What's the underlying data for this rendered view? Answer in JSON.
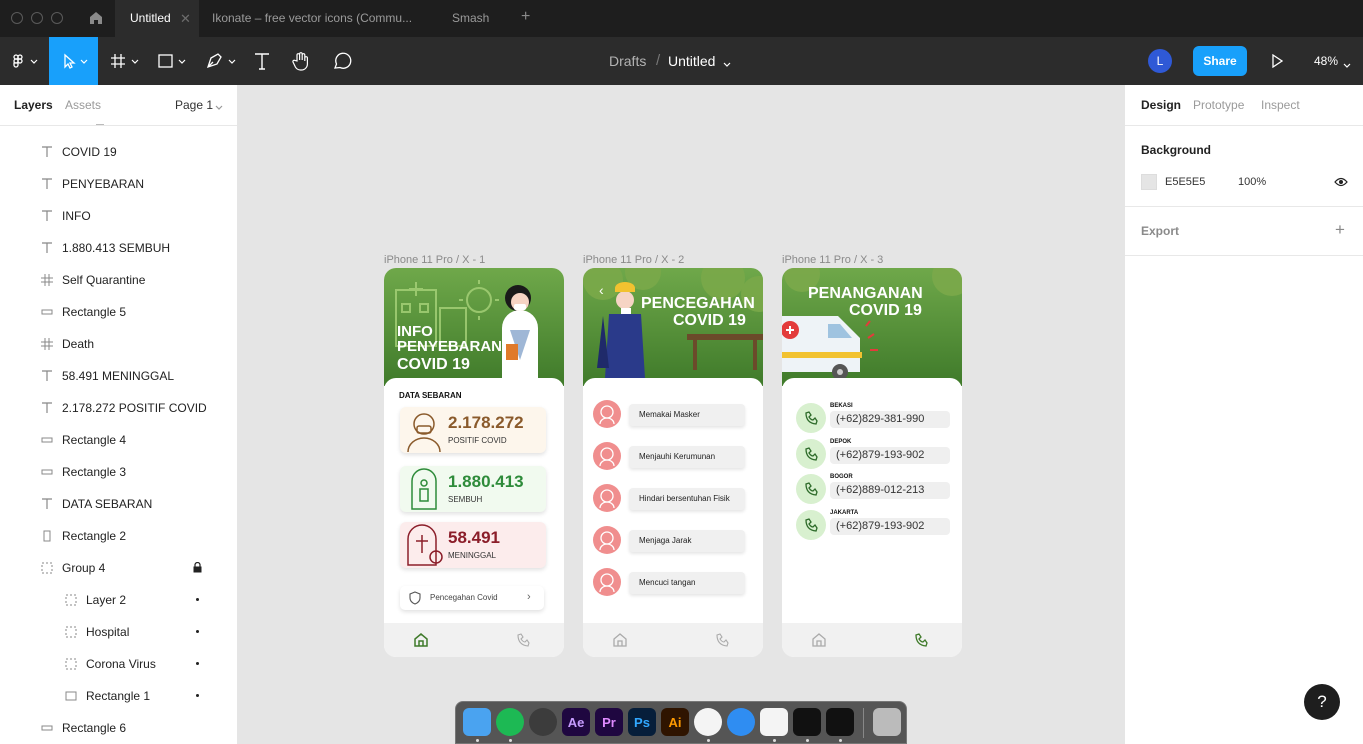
{
  "titlebar": {
    "tabs": [
      {
        "label": "Untitled"
      },
      {
        "label": "Ikonate – free vector icons (Commu..."
      },
      {
        "label": "Smash"
      }
    ]
  },
  "toolbar": {
    "breadcrumb_parent": "Drafts",
    "breadcrumb_sep": "/",
    "file_name": "Untitled",
    "avatar_initial": "L",
    "share_label": "Share",
    "zoom": "48%"
  },
  "left_panel": {
    "tabs": {
      "layers": "Layers",
      "assets": "Assets"
    },
    "page": "Page 1",
    "layers": [
      {
        "label": "COVID 19",
        "icon": "text-icon"
      },
      {
        "label": "PENYEBARAN",
        "icon": "text-icon"
      },
      {
        "label": "INFO",
        "icon": "text-icon"
      },
      {
        "label": "1.880.413 SEMBUH",
        "icon": "text-icon"
      },
      {
        "label": "Self Quarantine",
        "icon": "frame-icon"
      },
      {
        "label": "Rectangle 5",
        "icon": "rectangle-icon"
      },
      {
        "label": "Death",
        "icon": "frame-icon"
      },
      {
        "label": "58.491 MENINGGAL",
        "icon": "text-icon"
      },
      {
        "label": "2.178.272 POSITIF COVID",
        "icon": "text-icon"
      },
      {
        "label": "Rectangle 4",
        "icon": "rectangle-icon"
      },
      {
        "label": "Rectangle 3",
        "icon": "rectangle-icon"
      },
      {
        "label": "DATA SEBARAN",
        "icon": "text-icon"
      },
      {
        "label": "Rectangle 2",
        "icon": "rectangle-icon"
      },
      {
        "label": "Group 4",
        "icon": "group-icon"
      },
      {
        "label": "Layer 2",
        "icon": "group-icon"
      },
      {
        "label": "Hospital",
        "icon": "group-icon"
      },
      {
        "label": "Corona Virus",
        "icon": "group-icon"
      },
      {
        "label": "Rectangle 1",
        "icon": "rectangle-icon"
      },
      {
        "label": "Rectangle 6",
        "icon": "rectangle-icon"
      }
    ]
  },
  "right_panel": {
    "tabs": {
      "design": "Design",
      "prototype": "Prototype",
      "inspect": "Inspect"
    },
    "background_title": "Background",
    "bg_hex": "E5E5E5",
    "bg_opacity": "100%",
    "export_title": "Export"
  },
  "frames": {
    "f1": {
      "label": "iPhone 11 Pro / X - 1",
      "title1": "INFO",
      "title2": "PENYEBARAN",
      "title3": "COVID 19",
      "section": "DATA SEBARAN",
      "stat1_num": "2.178.272",
      "stat1_lbl": "POSITIF COVID",
      "stat2_num": "1.880.413",
      "stat2_lbl": "SEMBUH",
      "stat3_num": "58.491",
      "stat3_lbl": "MENINGGAL",
      "link": "Pencegahan Covid"
    },
    "f2": {
      "label": "iPhone 11 Pro / X - 2",
      "title1": "PENCEGAHAN",
      "title2": "COVID 19",
      "items": [
        "Memakai Masker",
        "Menjauhi  Kerumunan",
        "Hindari bersentuhan Fisik",
        "Menjaga Jarak",
        "Mencuci tangan"
      ]
    },
    "f3": {
      "label": "iPhone 11 Pro / X - 3",
      "title1": "PENANGANAN",
      "title2": "COVID 19",
      "contacts": [
        {
          "city": "BEKASI",
          "phone": "(+62)829-381-990"
        },
        {
          "city": "DEPOK",
          "phone": "(+62)879-193-902"
        },
        {
          "city": "BOGOR",
          "phone": "(+62)889-012-213"
        },
        {
          "city": "JAKARTA",
          "phone": "(+62)879-193-902"
        }
      ]
    }
  },
  "help": "?",
  "dock": {
    "apps": [
      {
        "name": "finder"
      },
      {
        "name": "spotify"
      },
      {
        "name": "blender"
      },
      {
        "name": "after-effects",
        "label": "Ae"
      },
      {
        "name": "premiere",
        "label": "Pr"
      },
      {
        "name": "photoshop",
        "label": "Ps"
      },
      {
        "name": "illustrator",
        "label": "Ai"
      },
      {
        "name": "chrome"
      },
      {
        "name": "safari"
      },
      {
        "name": "slack"
      },
      {
        "name": "terminal"
      },
      {
        "name": "figma"
      },
      {
        "name": "trash"
      }
    ]
  },
  "colors": {
    "accent": "#18a0fb",
    "green": "#3f7a2a",
    "stat_positive": "#8a5a2b",
    "stat_recovered": "#2e8b3a",
    "stat_death": "#8b1e2a"
  }
}
